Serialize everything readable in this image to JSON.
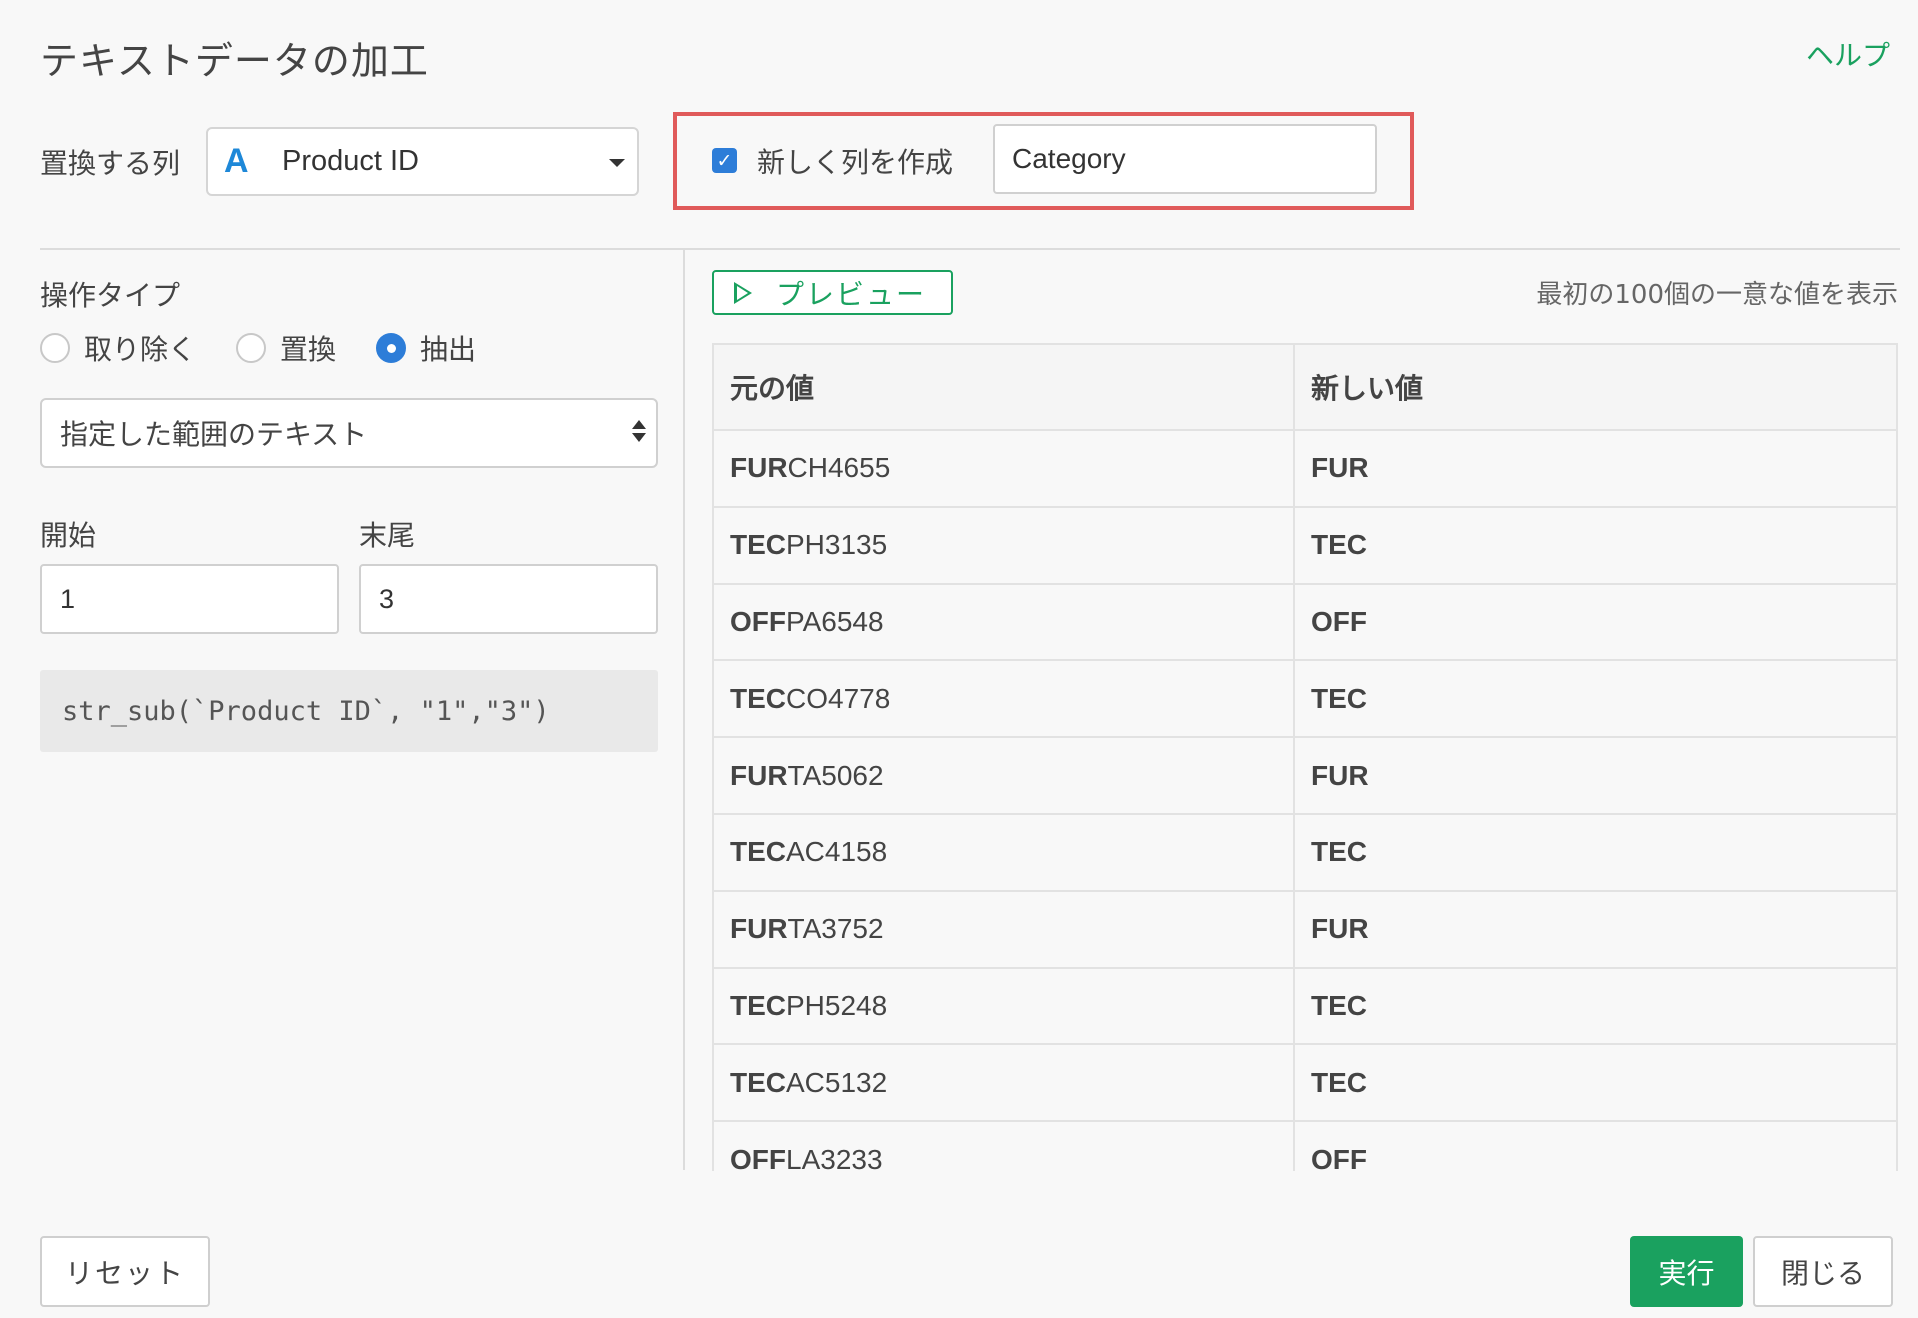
{
  "dialog": {
    "title": "テキストデータの加工",
    "help_label": "ヘルプ"
  },
  "column_row": {
    "label": "置換する列",
    "type_icon": "A",
    "selected_column": "Product ID",
    "new_column_checkbox_label": "新しく列を作成",
    "new_column_checked": true,
    "new_column_name": "Category"
  },
  "operation": {
    "label": "操作タイプ",
    "options": [
      {
        "label": "取り除く",
        "checked": false
      },
      {
        "label": "置換",
        "checked": false
      },
      {
        "label": "抽出",
        "checked": true
      }
    ],
    "mode_select_value": "指定した範囲のテキスト"
  },
  "range": {
    "start_label": "開始",
    "start_value": "1",
    "end_label": "末尾",
    "end_value": "3"
  },
  "code": "str_sub(`Product ID`, \"1\",\"3\")",
  "preview": {
    "button_label": "プレビュー",
    "note": "最初の100個の一意な値を表示",
    "columns": [
      "元の値",
      "新しい値"
    ],
    "rows": [
      {
        "prefix": "FUR",
        "suffix": "CH4655",
        "new": "FUR"
      },
      {
        "prefix": "TEC",
        "suffix": "PH3135",
        "new": "TEC"
      },
      {
        "prefix": "OFF",
        "suffix": "PA6548",
        "new": "OFF"
      },
      {
        "prefix": "TEC",
        "suffix": "CO4778",
        "new": "TEC"
      },
      {
        "prefix": "FUR",
        "suffix": "TA5062",
        "new": "FUR"
      },
      {
        "prefix": "TEC",
        "suffix": "AC4158",
        "new": "TEC"
      },
      {
        "prefix": "FUR",
        "suffix": "TA3752",
        "new": "FUR"
      },
      {
        "prefix": "TEC",
        "suffix": "PH5248",
        "new": "TEC"
      },
      {
        "prefix": "TEC",
        "suffix": "AC5132",
        "new": "TEC"
      },
      {
        "prefix": "OFF",
        "suffix": "LA3233",
        "new": "OFF"
      }
    ]
  },
  "footer": {
    "reset_label": "リセット",
    "run_label": "実行",
    "close_label": "閉じる"
  },
  "colors": {
    "accent_green": "#1aa15f",
    "checkbox_blue": "#2d7dd8",
    "highlight_red": "#e05a5a"
  }
}
